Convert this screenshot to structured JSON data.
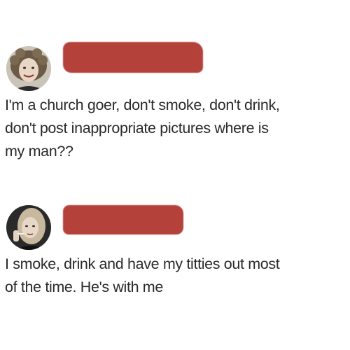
{
  "posts": [
    {
      "avatar": "avatar-woman-blonde-curly-hair",
      "author_redacted": true,
      "redaction_color": "#b4413a",
      "text": "I'm a church goer, don't smoke, don't drink,\ndon't post inappropriate pictures where is\nmy man??"
    },
    {
      "avatar": "avatar-woman-smoking",
      "author_redacted": true,
      "redaction_color": "#b4413a",
      "text": "I smoke, drink and have my titties out most\nof the time. He's with me"
    }
  ]
}
